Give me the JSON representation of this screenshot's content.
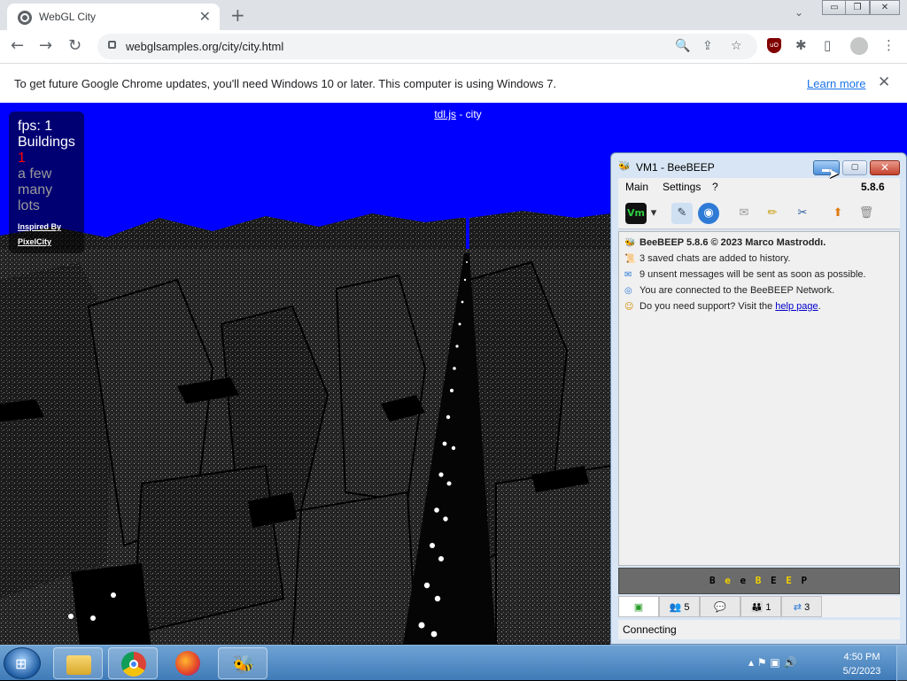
{
  "browser": {
    "tab_title": "WebGL City",
    "tab_close": "✕",
    "new_tab": "+",
    "tab_dropdown": "⌄",
    "window_controls": {
      "minimize": "▭",
      "restore": "❐",
      "close": "✕"
    },
    "url": "webglsamples.org/city/city.html",
    "nav": {
      "back": "←",
      "forward": "→",
      "reload": "↻"
    },
    "omnibox_icons": {
      "search": "🔍",
      "share": "⇪",
      "bookmark": "☆"
    },
    "toolbar_icons": {
      "ublock": "uO",
      "extensions": "✱",
      "sidebar": "▯",
      "menu": "⋮"
    }
  },
  "infobar": {
    "message": "To get future Google Chrome updates, you'll need Windows 10 or later. This computer is using Windows 7.",
    "link": "Learn more",
    "close": "✕"
  },
  "page": {
    "title_link": "tdl.js",
    "title_rest": " - city",
    "stats": {
      "fps": "fps: 1",
      "buildings_label": "Buildings",
      "options": [
        "1",
        "a few",
        "many",
        "lots"
      ],
      "selected_index": 0,
      "inspired_by": "Inspired By",
      "inspired_link": "PixelCity"
    },
    "sky_color": "#0000ff"
  },
  "beebeep": {
    "window_title": "VM1 - BeeBEEP",
    "menus": [
      "Main",
      "Settings",
      "?"
    ],
    "version": "5.8.6",
    "toolbar_icons": [
      "vm-status-icon",
      "dropdown-arrow-icon",
      "edit-profile-icon",
      "network-icon",
      "mail-icon",
      "note-icon",
      "tools-icon",
      "update-icon",
      "trash-icon"
    ],
    "vm_label": "Vm",
    "log": [
      {
        "icon": "bee-icon",
        "glyph": "🐝",
        "text": "BeeBEEP 5.8.6 © 2023 Marco Mastroddı.",
        "bold": true
      },
      {
        "icon": "history-icon",
        "glyph": "📜",
        "text": "3 saved chats are added to history."
      },
      {
        "icon": "envelope-icon",
        "glyph": "✉",
        "text": "9 unsent messages will be sent as soon as possible."
      },
      {
        "icon": "network-icon",
        "glyph": "◎",
        "text": "You are connected to the BeeBEEP Network."
      },
      {
        "icon": "support-icon",
        "glyph": "☺",
        "text": "Do you need support? Visit the ",
        "link": "help page",
        "after": "."
      }
    ],
    "brand_letters": [
      "B",
      "e",
      "e",
      "B",
      "E",
      "E",
      "P"
    ],
    "tabs": [
      {
        "name": "home-tab",
        "label": ""
      },
      {
        "name": "users-tab",
        "label": "5"
      },
      {
        "name": "chats-tab",
        "label": ""
      },
      {
        "name": "groups-tab",
        "label": "1"
      },
      {
        "name": "files-tab",
        "label": "3"
      }
    ],
    "status": "Connecting"
  },
  "taskbar": {
    "apps": [
      "explorer-app",
      "chrome-app",
      "firefox-app",
      "beebeep-app"
    ],
    "clock_time": "4:50 PM",
    "clock_date": "5/2/2023",
    "tray_icons": "▴  ⚑  ▣  🔊"
  }
}
